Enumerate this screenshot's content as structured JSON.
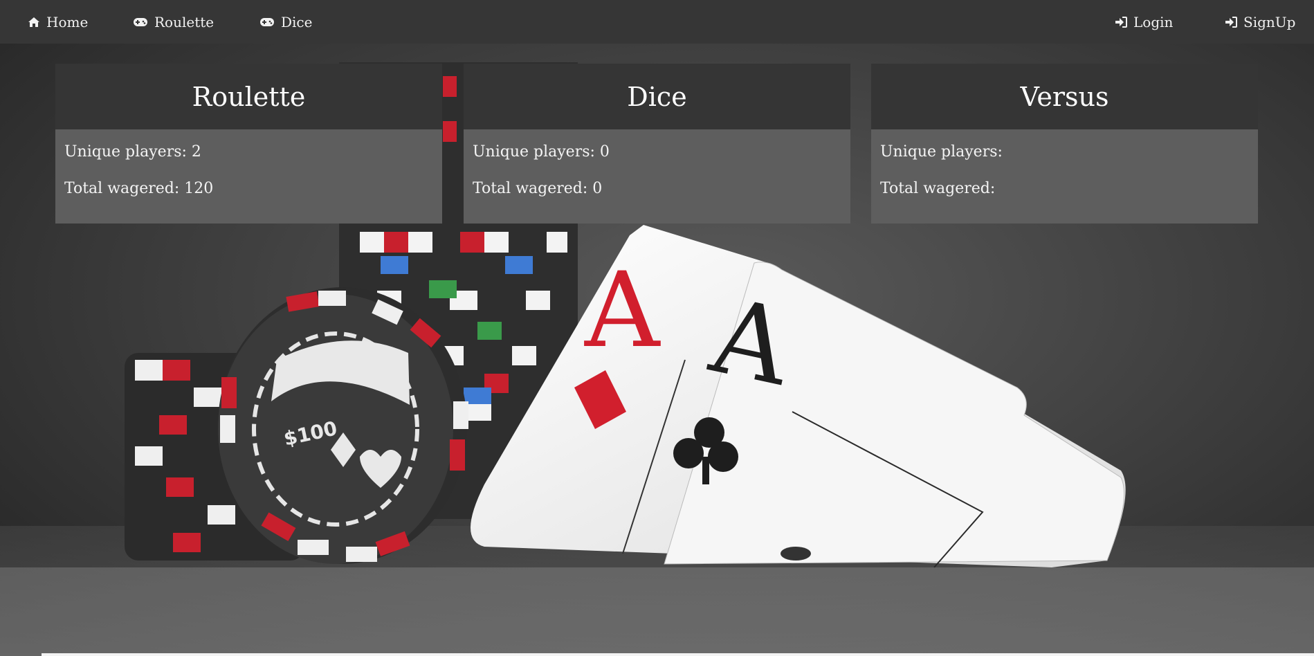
{
  "nav": {
    "home": "Home",
    "roulette": "Roulette",
    "dice": "Dice",
    "login": "Login",
    "signup": "SignUp"
  },
  "cards": [
    {
      "title": "Roulette",
      "players_label": "Unique players: 2",
      "wagered_label": "Total wagered: 120"
    },
    {
      "title": "Dice",
      "players_label": "Unique players: 0",
      "wagered_label": "Total wagered: 0"
    },
    {
      "title": "Versus",
      "players_label": "Unique players:",
      "wagered_label": "Total wagered:"
    }
  ],
  "hero": {
    "chip_value": "$100"
  },
  "icons": {
    "home": "home-icon",
    "roulette": "gamepad-icon",
    "dice": "gamepad-icon",
    "login": "sign-in-icon",
    "signup": "sign-in-icon"
  },
  "colors": {
    "navbar": "#363636",
    "card_header": "#353535",
    "card_body": "#5e5e5e",
    "chip_red": "#c8202d"
  }
}
